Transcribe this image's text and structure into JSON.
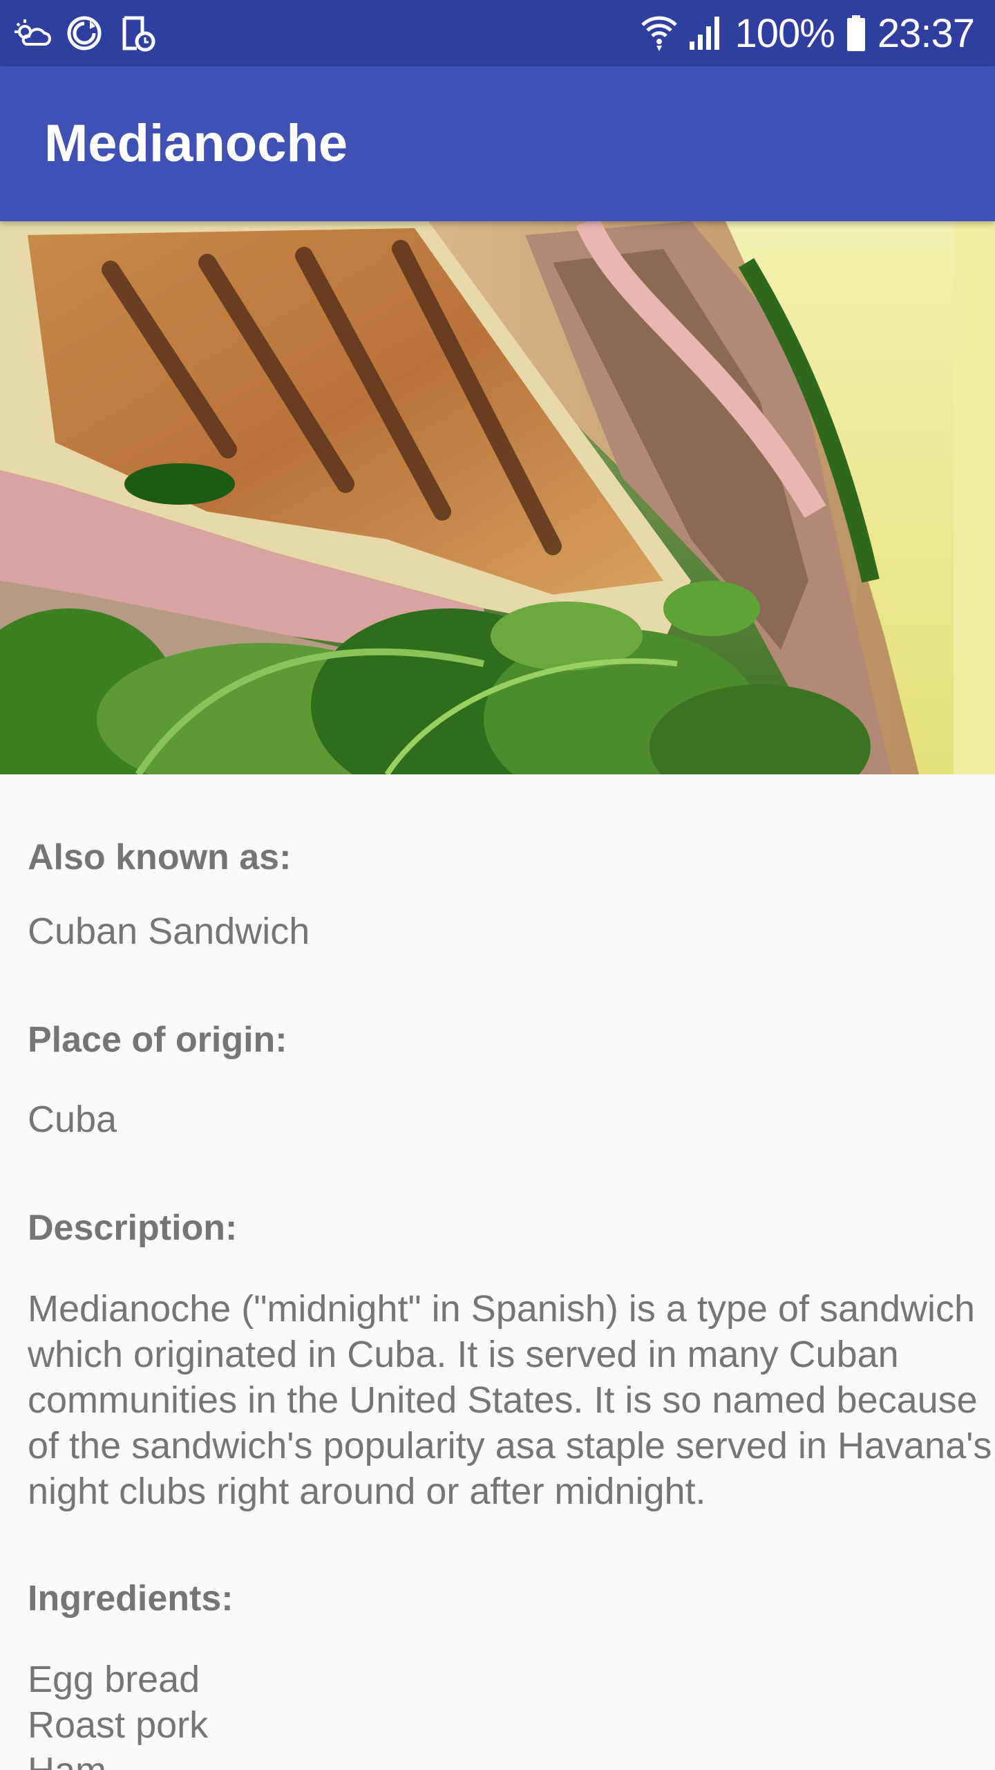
{
  "status_bar": {
    "battery": "100%",
    "time": "23:37",
    "left_icons": [
      "weather-icon",
      "sync-icon",
      "clipboard-clock-icon"
    ],
    "right_icons": [
      "wifi-icon",
      "signal-icon",
      "battery-icon"
    ]
  },
  "app_bar": {
    "title": "Medianoche"
  },
  "hero": {
    "image": "sandwich-photo"
  },
  "details": {
    "also_known_as_label": "Also known as:",
    "also_known_as_value": "Cuban Sandwich",
    "place_of_origin_label": "Place of origin:",
    "place_of_origin_value": "Cuba",
    "description_label": "Description:",
    "description_lines": [
      "Medianoche (\"midnight\" in Spanish) is a type of sandwich",
      "which originated in Cuba. It is served in many Cuban",
      "communities in the United States. It is so named because",
      "of the sandwich's popularity asa staple served in Havana's",
      "night clubs right around or after midnight."
    ],
    "ingredients_label": "Ingredients:",
    "ingredients": [
      "Egg bread",
      "Roast pork",
      "Ham"
    ]
  },
  "colors": {
    "status_bar": "#2f3f9f",
    "app_bar": "#3f51b5",
    "background": "#fafafa",
    "text": "#757575"
  }
}
